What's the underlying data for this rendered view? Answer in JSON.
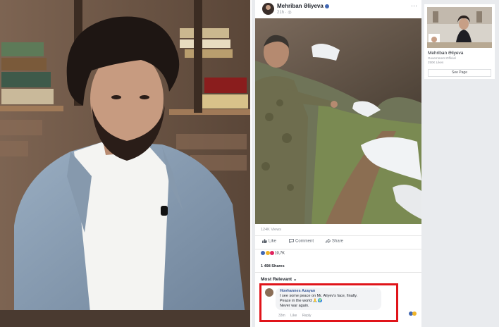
{
  "post": {
    "page_name": "Mehriban Əliyeva",
    "meta": "21h · ",
    "more_icon": "more-dots-icon",
    "views": "124K Views",
    "actions": [
      {
        "label": "Like",
        "icon": "like-icon"
      },
      {
        "label": "Comment",
        "icon": "comment-icon"
      },
      {
        "label": "Share",
        "icon": "share-icon"
      }
    ],
    "reaction_count": "10,7K",
    "shares": "1 498 Shares",
    "filter_label": "Most Relevant"
  },
  "comment": {
    "author": "Hovhannes Azayan",
    "lines": [
      "I see some peace on Mr. Aliyev's face, finally.",
      "Peace in the world 🙏🌍",
      "Never war again."
    ],
    "time": "33m",
    "like": "Like",
    "reply": "Reply"
  },
  "sidebar": {
    "name": "Mehriban Əliyeva",
    "category": "Government Official",
    "likes": "250K Likes",
    "button": "See Page"
  },
  "colors": {
    "highlight": "#e0141a",
    "fb_blue": "#4267b2"
  }
}
